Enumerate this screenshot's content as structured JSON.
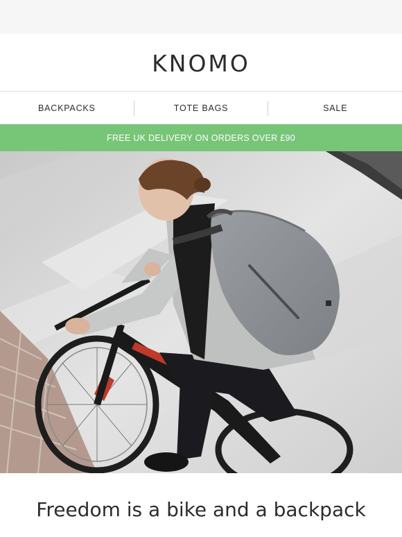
{
  "brand": {
    "name": "KNOMO"
  },
  "nav": {
    "items": [
      {
        "label": "BACKPACKS"
      },
      {
        "label": "TOTE BAGS"
      },
      {
        "label": "SALE"
      }
    ]
  },
  "banner": {
    "text": "FREE UK DELIVERY ON ORDERS OVER £90",
    "color": "#77c577"
  },
  "hero": {
    "headline": "Freedom is a bike and a backpack"
  }
}
